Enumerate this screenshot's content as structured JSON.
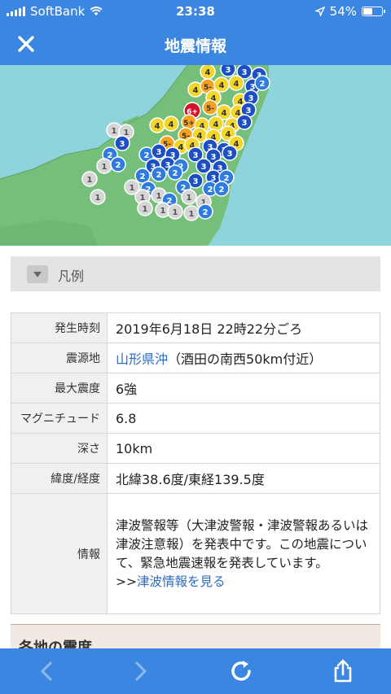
{
  "status_bar": {
    "carrier": "SoftBank",
    "time": "23:38",
    "battery": "54%",
    "battery_level": 0.54,
    "icons": [
      "signal-icon",
      "wifi-icon",
      "location-arrow-icon",
      "battery-icon"
    ]
  },
  "nav": {
    "title": "地震情報",
    "close_icon": "close-icon"
  },
  "map": {
    "intensity_markers": [
      "1",
      "2",
      "3",
      "4",
      "5-",
      "5+",
      "6+"
    ],
    "epicenter_intensity": "6+",
    "colors": {
      "sea": "#8fd3dc",
      "land": "#75bf7a",
      "i1": "#d5d5d5",
      "i2": "#2f7be0",
      "i3": "#1d4fc2",
      "i4": "#f3d52b",
      "i5m": "#f4a21f",
      "i6p": "#d0152c"
    }
  },
  "legend": {
    "label": "凡例"
  },
  "info_table": {
    "rows": [
      {
        "label": "発生時刻",
        "value": "2019年6月18日 22時22分ごろ"
      },
      {
        "label": "震源地",
        "value_link": "山形県沖",
        "value": "（酒田の南西50km付近）"
      },
      {
        "label": "最大震度",
        "value": "6強"
      },
      {
        "label": "マグニチュード",
        "value": "6.8"
      },
      {
        "label": "深さ",
        "value": "10km"
      },
      {
        "label": "緯度/経度",
        "value": "北緯38.6度/東経139.5度"
      },
      {
        "label": "情報",
        "value": "津波警報等（大津波警報・津波警報あるいは津波注意報）を発表中です。この地震について、緊急地震速報を発表しています。",
        "link_prefix": ">>",
        "link_text": "津波情報を見る"
      }
    ]
  },
  "regions_header": {
    "label": "各地の震度"
  },
  "toolbar": {
    "back_icon": "back-arrow-icon",
    "forward_icon": "forward-arrow-icon",
    "reload_icon": "reload-icon",
    "share_icon": "share-icon",
    "accent": "#3b86e1"
  }
}
